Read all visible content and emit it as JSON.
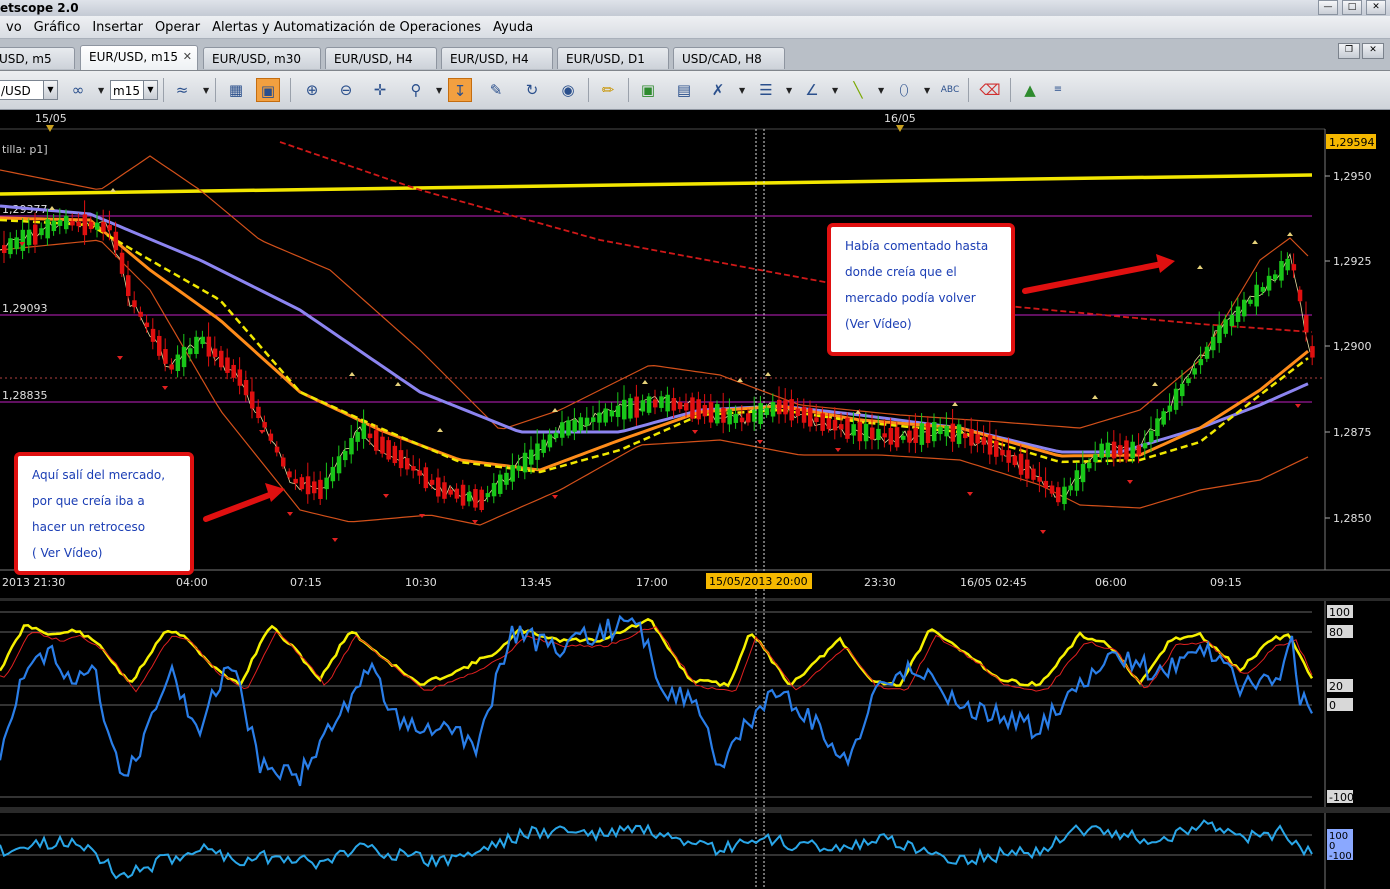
{
  "window": {
    "title": "etscope 2.0"
  },
  "menu": [
    "vo",
    "Gráfico",
    "Insertar",
    "Operar",
    "Alertas y Automatización de Operaciones",
    "Ayuda"
  ],
  "tabs": [
    {
      "label": "USD, m5"
    },
    {
      "label": "EUR/USD, m15",
      "active": true
    },
    {
      "label": "EUR/USD, m30"
    },
    {
      "label": "EUR/USD, H4"
    },
    {
      "label": "EUR/USD, H4"
    },
    {
      "label": "EUR/USD, D1"
    },
    {
      "label": "USD/CAD, H8"
    }
  ],
  "toolbar": {
    "symbol_value": "/USD",
    "timeframe_value": "m15",
    "icons": [
      "bar-type-icon",
      "link-icon",
      "chart-style-icon",
      "table-icon",
      "template-icon",
      "zoom-in-icon",
      "zoom-out-icon",
      "crosshair-icon",
      "zoom-window-icon",
      "auto-scroll-icon",
      "edit-icon",
      "refresh-icon",
      "globe-icon",
      "ruler-icon",
      "image-icon",
      "layout-icon",
      "tools-icon",
      "lines-icon",
      "fan-icon",
      "pen-icon",
      "ellipse-icon",
      "text-icon",
      "eraser-icon",
      "tree-icon",
      "more-icon"
    ]
  },
  "chart": {
    "indicator_label": "tilla: p1]",
    "date_markers": [
      "15/05",
      "16/05"
    ],
    "current_price": "1,29594",
    "price_ticks": [
      "1,2950",
      "1,2925",
      "1,2900",
      "1,2875",
      "1,2850"
    ],
    "level_labels": [
      "1,29377",
      "1,29093",
      "1,28835"
    ],
    "time_ticks": [
      "2013 21:30",
      "04:00",
      "07:15",
      "10:30",
      "13:45",
      "17:00",
      "23:30",
      "16/05 02:45",
      "06:00",
      "09:15"
    ],
    "crosshair_time": "15/05/2013 20:00",
    "osc1_ticks": [
      "100",
      "80",
      "20",
      "0",
      "-100"
    ],
    "osc2_ticks": [
      "100",
      "0",
      "-100"
    ]
  },
  "annotations": {
    "right": [
      "Había comentado hasta",
      "donde creía que el",
      "mercado podía volver",
      "(Ver Vídeo)"
    ],
    "left": [
      "Aquí salí del mercado,",
      "por que creía  iba a",
      "hacer un retroceso",
      "( Ver Vídeo)"
    ]
  },
  "colors": {
    "background": "#000000",
    "bull_candle": "#19c619",
    "bear_candle": "#e01010",
    "yellow_line": "#f2e600",
    "ma_blue": "#8c84f0",
    "ma_orange": "#ff8c1a",
    "bollinger": "#d2501a",
    "level_magenta": "#c020c0",
    "osc_yellow": "#f5f000",
    "osc_red": "#e02020",
    "osc_blue": "#2a7ee8",
    "osc2_cyan": "#2aa6e8",
    "current_price_bg": "#f5b800"
  }
}
